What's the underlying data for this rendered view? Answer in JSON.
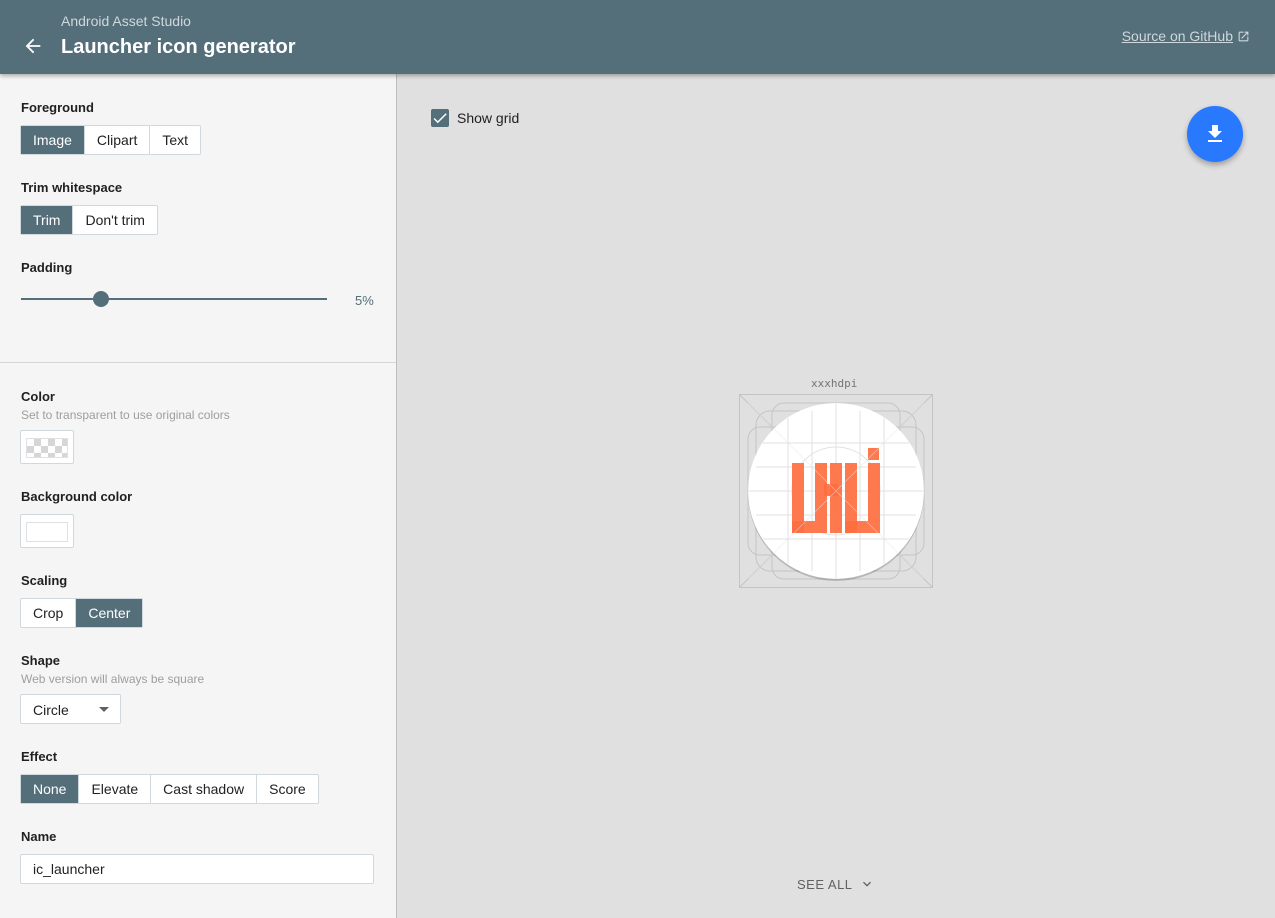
{
  "header": {
    "subtitle": "Android Asset Studio",
    "title": "Launcher icon generator",
    "github_link": "Source on GitHub",
    "back_icon": "arrow-back-icon",
    "external_icon": "open-in-new-icon"
  },
  "sidebar": {
    "foreground": {
      "label": "Foreground",
      "options": [
        "Image",
        "Clipart",
        "Text"
      ],
      "selected": "Image"
    },
    "trim": {
      "label": "Trim whitespace",
      "options": [
        "Trim",
        "Don't trim"
      ],
      "selected": "Trim"
    },
    "padding": {
      "label": "Padding",
      "value": "5%",
      "fraction": 0.25
    },
    "color": {
      "label": "Color",
      "hint": "Set to transparent to use original colors",
      "value": "transparent"
    },
    "background_color": {
      "label": "Background color",
      "value": "#ffffff"
    },
    "scaling": {
      "label": "Scaling",
      "options": [
        "Crop",
        "Center"
      ],
      "selected": "Center"
    },
    "shape": {
      "label": "Shape",
      "hint": "Web version will always be square",
      "value": "Circle"
    },
    "effect": {
      "label": "Effect",
      "options": [
        "None",
        "Elevate",
        "Cast shadow",
        "Score"
      ],
      "selected": "None"
    },
    "name": {
      "label": "Name",
      "value": "ic_launcher"
    }
  },
  "main": {
    "show_grid_label": "Show grid",
    "show_grid_checked": true,
    "download_icon": "download-icon",
    "density_label": "xxxhdpi",
    "see_all": "SEE ALL",
    "see_all_icon": "chevron-down-icon"
  },
  "colors": {
    "primary": "#546e7a",
    "accent": "#2979ff",
    "icon_foreground": "#ff6e40"
  }
}
